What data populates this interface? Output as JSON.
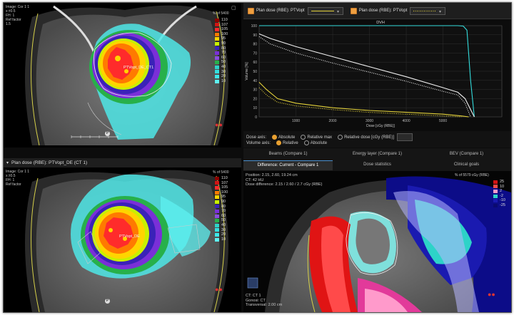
{
  "top_left": {
    "overlay_lines": [
      "Image: Cor 1 1",
      "x:±0.5",
      "FH: 1",
      "Ref factor",
      "1.5"
    ],
    "dose_scale_title": "% of 5400",
    "legend": [
      {
        "label": "110",
        "color": "#8b0000"
      },
      {
        "label": "107",
        "color": "#d21414"
      },
      {
        "label": "105",
        "color": "#ff2b2b"
      },
      {
        "label": "100",
        "color": "#ff7a00"
      },
      {
        "label": "95",
        "color": "#ffd400"
      },
      {
        "label": "90",
        "color": "#c8f000"
      },
      {
        "label": "80",
        "color": "#3a22b8"
      },
      {
        "label": "70",
        "color": "#7a2fd8"
      },
      {
        "label": "60",
        "color": "#8a4de0"
      },
      {
        "label": "50",
        "color": "#27b04a"
      },
      {
        "label": "40",
        "color": "#2dd3c8"
      },
      {
        "label": "30",
        "color": "#34e0e0"
      },
      {
        "label": "20",
        "color": "#3ce8ea"
      },
      {
        "label": "10",
        "color": "#5ef0f0"
      }
    ],
    "roi_label": "PTVopt_DE_CT1",
    "marker": "P"
  },
  "bottom_left": {
    "header": "Plan dose (RBE): PTVopt_DE (CT 1)",
    "overlay_lines": [
      "Image: Cor 1 1",
      "x:±0.5",
      "FH: 1",
      "Ref factor"
    ],
    "dose_scale_title": "% of 5400",
    "roi_label": "PTVopt_DE",
    "marker": "P"
  },
  "dvh": {
    "series_header": [
      {
        "label": "Plan dose (RBE): PTVopt"
      },
      {
        "label": "Plan dose (RBE): PTVopt"
      }
    ],
    "dose_axis_label": "Dose axis:",
    "dose_axis_options": [
      "Absolute",
      "Relative max",
      "Relative dose [cGy (RBE)]"
    ],
    "dose_axis_selected": "Absolute",
    "volume_axis_label": "Volume axis:",
    "volume_axis_options": [
      "Relative",
      "Absolute"
    ],
    "volume_axis_selected": "Relative"
  },
  "chart_data": {
    "type": "line",
    "title": "DVH",
    "xlabel": "Dose [cGy (RBE)]",
    "ylabel": "Volume [%]",
    "xlim": [
      0,
      6600
    ],
    "ylim": [
      0,
      100
    ],
    "xticks": [
      1000,
      2000,
      3000,
      4000,
      5000
    ],
    "yticks": [
      0,
      10,
      20,
      30,
      40,
      50,
      60,
      70,
      80,
      90,
      100
    ],
    "grid": true,
    "series": [
      {
        "color": "#33dcdc",
        "dash": "solid",
        "x": [
          0,
          5000,
          5400,
          5550,
          5650,
          5750,
          5850
        ],
        "y": [
          100,
          100,
          100,
          99.5,
          95,
          40,
          0
        ]
      },
      {
        "color": "#f0f0f0",
        "dash": "solid",
        "x": [
          0,
          300,
          1000,
          2000,
          3000,
          4000,
          5000,
          5400,
          5600,
          5750,
          5850
        ],
        "y": [
          91,
          86,
          77,
          66,
          55,
          44,
          32,
          27,
          20,
          8,
          0
        ]
      },
      {
        "color": "#f0f0f0",
        "dash": "dotted",
        "x": [
          0,
          300,
          1000,
          2000,
          3000,
          4000,
          5000,
          5400,
          5600,
          5750
        ],
        "y": [
          88,
          80,
          70,
          59,
          49,
          39,
          28,
          24,
          15,
          0
        ]
      },
      {
        "color": "#e4d23a",
        "dash": "solid",
        "x": [
          0,
          200,
          500,
          1000,
          2000,
          3000,
          4000,
          5000,
          5500,
          5700
        ],
        "y": [
          38,
          30,
          20,
          15,
          10,
          7,
          5,
          3,
          1,
          0
        ]
      },
      {
        "color": "#e4d23a",
        "dash": "dotted",
        "x": [
          0,
          200,
          500,
          1000,
          2000,
          3000,
          4000,
          5000,
          5500
        ],
        "y": [
          32,
          24,
          16,
          12,
          8,
          5,
          3,
          1,
          0
        ]
      }
    ]
  },
  "tabs_row1": [
    {
      "label": "Beams (Compare 1)"
    },
    {
      "label": "Energy layer (Compare 1)"
    },
    {
      "label": "BEV (Compare 1)"
    }
  ],
  "tabs_row2": [
    {
      "label": "Difference: Current - Compare 1",
      "active": true
    },
    {
      "label": "Dose statistics",
      "active": false
    },
    {
      "label": "Clinical goals",
      "active": false
    }
  ],
  "bottom_right": {
    "overlay_lines": [
      "Position: 2.15, 2.60, 19.24 cm",
      "CT: 42 HU",
      "Dose difference: 2.15 / 2.60 / 2.7 cGy (RBE)"
    ],
    "dose_scale_title": "% of 5579 cGy (RBE)",
    "legend": [
      {
        "label": "25",
        "color": "#d41414"
      },
      {
        "label": "10",
        "color": "#ff4a4a"
      },
      {
        "label": "2",
        "color": "#ff9acb"
      },
      {
        "label": "-2",
        "color": "#2dd3c8"
      },
      {
        "label": "-10",
        "color": "#1a1ab0"
      },
      {
        "label": "-25",
        "color": "#0a0a70"
      }
    ],
    "footer_lines": [
      "CT: CT 1",
      "Gonosi: CT",
      "Transversal: 2.00 cm"
    ]
  }
}
